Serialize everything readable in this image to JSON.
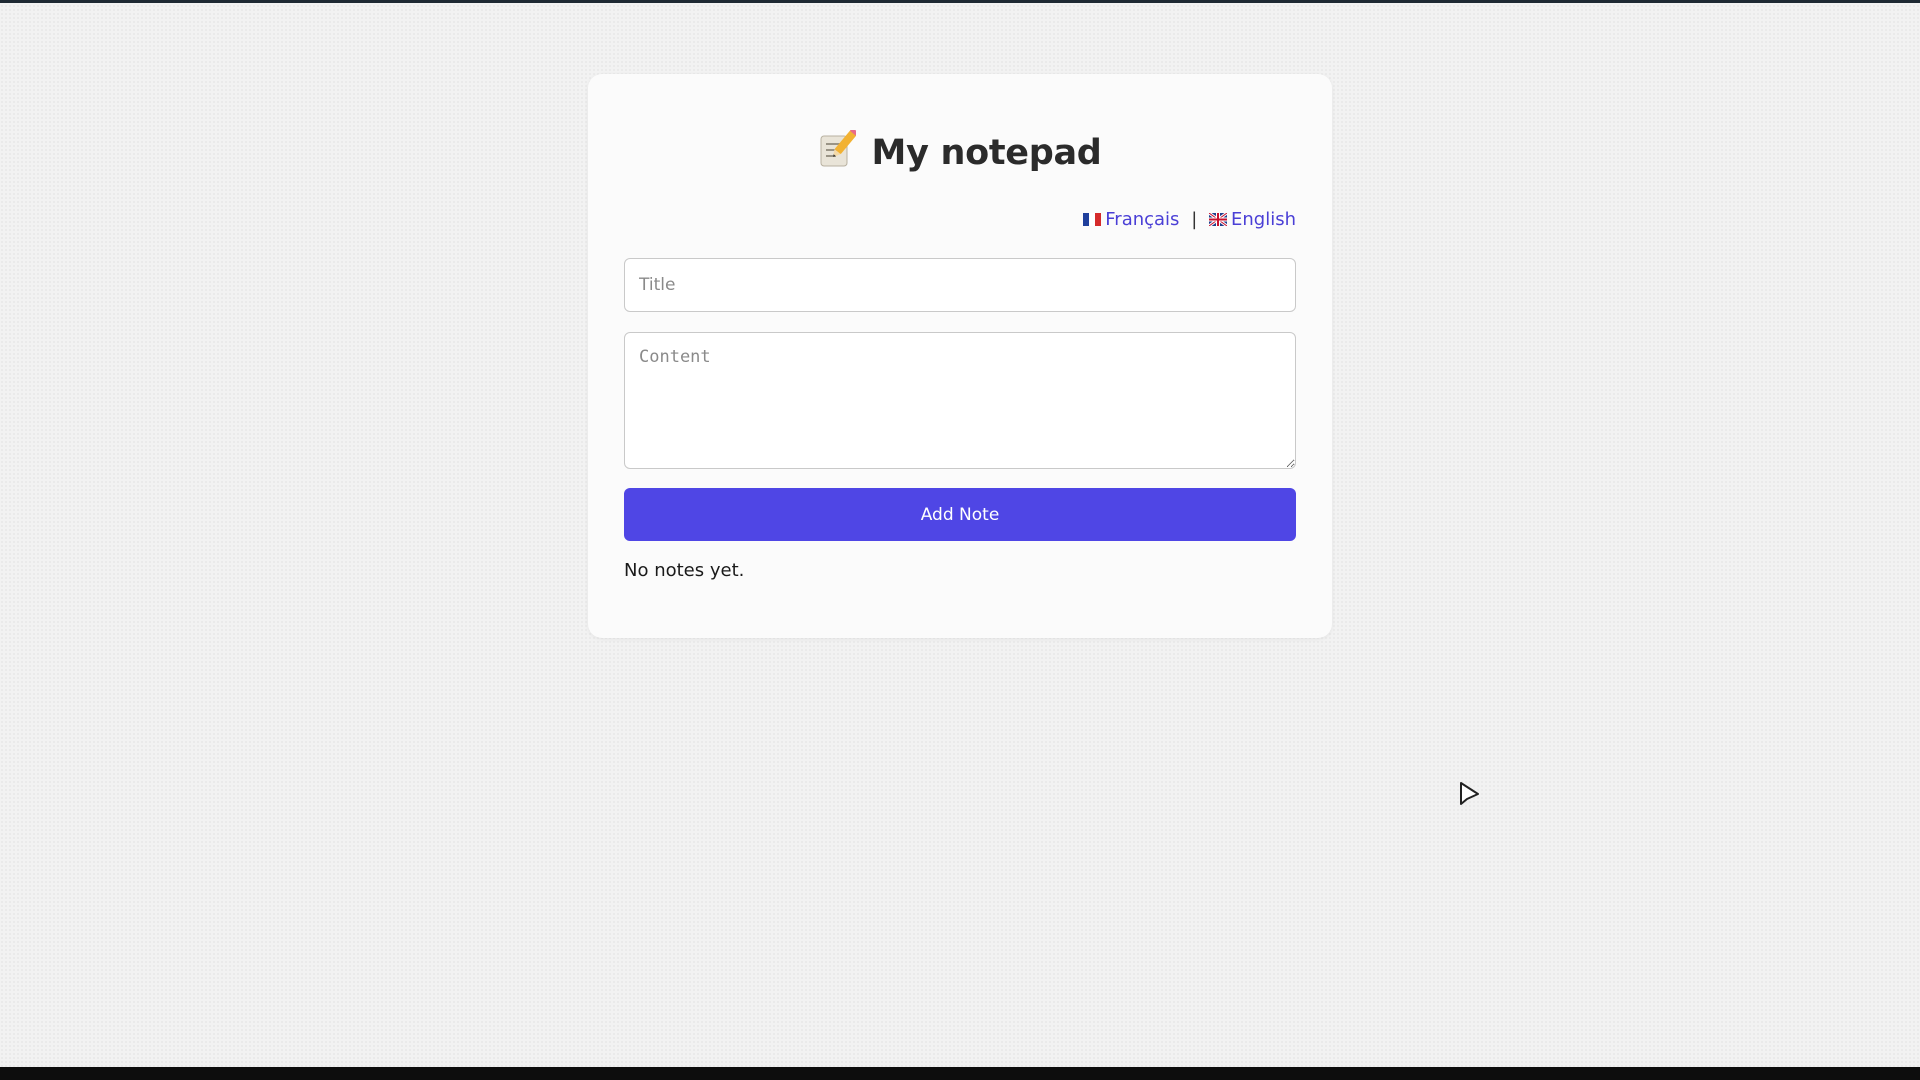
{
  "header": {
    "title": "My notepad",
    "emoji_icon": "memo-pencil-icon"
  },
  "languages": {
    "french_label": "Français",
    "french_flag": "france-flag-icon",
    "separator": "|",
    "english_label": "English",
    "english_flag": "uk-flag-icon"
  },
  "form": {
    "title_placeholder": "Title",
    "title_value": "",
    "content_placeholder": "Content",
    "content_value": "",
    "add_button_label": "Add Note"
  },
  "notes": {
    "empty_message": "No notes yet."
  },
  "colors": {
    "accent": "#4f46e5",
    "link": "#4a3fd6",
    "card_background": "#fbfbfb",
    "page_background": "#f2f2f2"
  }
}
